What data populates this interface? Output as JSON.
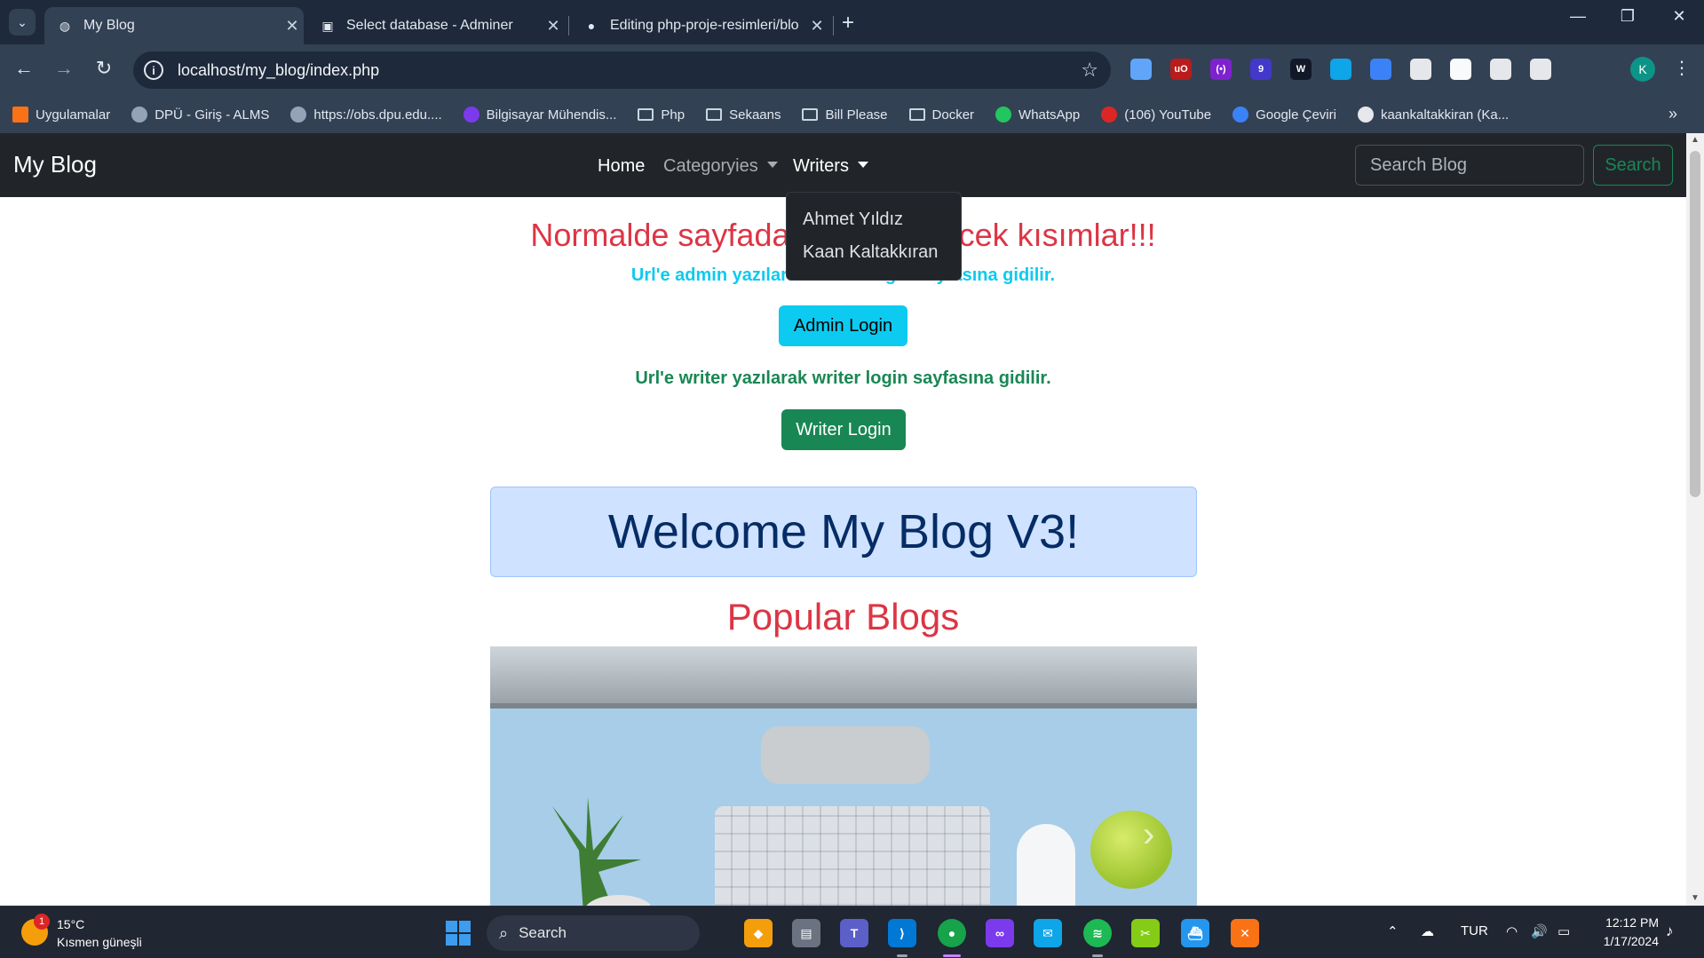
{
  "browser": {
    "tabs": [
      {
        "title": "My Blog",
        "active": true
      },
      {
        "title": "Select database - Adminer",
        "active": false
      },
      {
        "title": "Editing php-proje-resimleri/blo",
        "active": false
      }
    ],
    "url": "localhost/my_blog/index.php",
    "profile_initial": "K",
    "extensions": [
      {
        "icon": "dev-tools-icon",
        "color": "#60a5fa"
      },
      {
        "icon": "ublock-icon",
        "label": "uO",
        "color": "#b91c1c"
      },
      {
        "icon": "brackets-icon",
        "label": "(•)",
        "color": "#7e22ce"
      },
      {
        "icon": "badge-extension-icon",
        "label": "9",
        "color": "#4338ca"
      },
      {
        "icon": "wappalyzer-icon",
        "label": "W",
        "color": "#111827"
      },
      {
        "icon": "edge-icon",
        "color": "#0ea5e9"
      },
      {
        "icon": "docs-icon",
        "color": "#3b82f6"
      },
      {
        "icon": "ghostery-icon",
        "color": "#e5e7eb"
      },
      {
        "icon": "record-icon",
        "color": "#f8fafc"
      },
      {
        "icon": "color-picker-icon",
        "color": "#e5e7eb"
      },
      {
        "icon": "puzzle-icon",
        "color": "#e5e7eb"
      }
    ]
  },
  "bookmarks": [
    {
      "label": "Uygulamalar",
      "icon": "apps-grid-icon",
      "color": "#f97316"
    },
    {
      "label": "DPÜ - Giriş - ALMS",
      "icon": "globe-icon",
      "color": "#94a3b8"
    },
    {
      "label": "https://obs.dpu.edu....",
      "icon": "globe-icon",
      "color": "#94a3b8"
    },
    {
      "label": "Bilgisayar Mühendis...",
      "icon": "university-icon",
      "color": "#7c3aed"
    },
    {
      "label": "Php",
      "icon": "folder-icon"
    },
    {
      "label": "Sekaans",
      "icon": "folder-icon"
    },
    {
      "label": "Bill Please",
      "icon": "folder-icon"
    },
    {
      "label": "Docker",
      "icon": "folder-icon"
    },
    {
      "label": "WhatsApp",
      "icon": "whatsapp-icon",
      "color": "#22c55e"
    },
    {
      "label": "(106) YouTube",
      "icon": "youtube-icon",
      "color": "#dc2626"
    },
    {
      "label": "Google Çeviri",
      "icon": "translate-icon",
      "color": "#3b82f6"
    },
    {
      "label": "kaankaltakkiran (Ka...",
      "icon": "github-icon",
      "color": "#e5e7eb"
    }
  ],
  "site": {
    "brand": "My Blog",
    "nav": {
      "home": "Home",
      "categories": "Categoryies",
      "writers": "Writers"
    },
    "search_placeholder": "Search Blog",
    "search_button": "Search",
    "writers_dropdown": [
      "Ahmet Yıldız",
      "Kaan Kaltakkıran"
    ],
    "headline": "Normalde sayfada görünmeyecek kısımlar!!!",
    "admin_note": "Url'e admin yazılarak admin login sayfasına gidilir.",
    "admin_button": "Admin Login",
    "writer_note": "Url'e writer yazılarak writer login sayfasına gidilir.",
    "writer_button": "Writer Login",
    "welcome": "Welcome My Blog V3!",
    "popular_title": "Popular Blogs"
  },
  "taskbar": {
    "weather_temp": "15°C",
    "weather_desc": "Kısmen güneşli",
    "weather_badge": "1",
    "search_label": "Search",
    "language": "TUR",
    "time": "12:12 PM",
    "date": "1/17/2024"
  },
  "colors": {
    "danger": "#dc3545",
    "info": "#0dcaf0",
    "success": "#198754",
    "primary_subtle": "#cfe2ff",
    "navbar": "#212529"
  }
}
